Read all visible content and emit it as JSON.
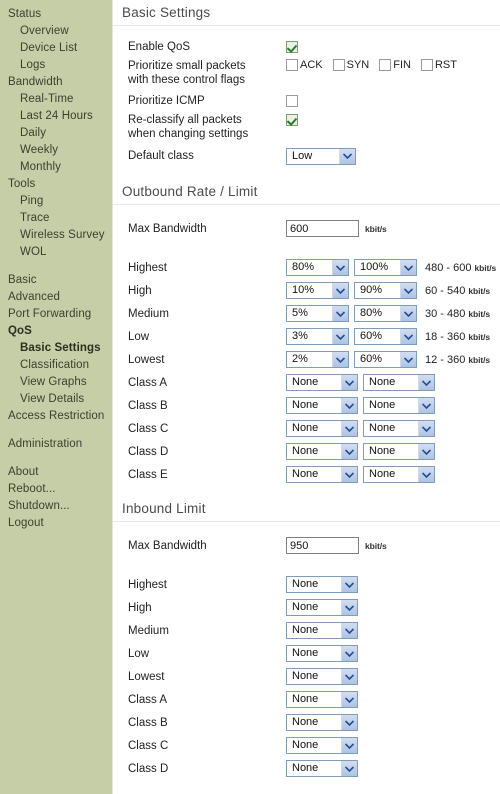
{
  "sidebar": {
    "items": [
      {
        "label": "Status",
        "level": 0,
        "active": false
      },
      {
        "label": "Overview",
        "level": 1,
        "active": false
      },
      {
        "label": "Device List",
        "level": 1,
        "active": false
      },
      {
        "label": "Logs",
        "level": 1,
        "active": false
      },
      {
        "label": "Bandwidth",
        "level": 0,
        "active": false
      },
      {
        "label": "Real-Time",
        "level": 1,
        "active": false
      },
      {
        "label": "Last 24 Hours",
        "level": 1,
        "active": false
      },
      {
        "label": "Daily",
        "level": 1,
        "active": false
      },
      {
        "label": "Weekly",
        "level": 1,
        "active": false
      },
      {
        "label": "Monthly",
        "level": 1,
        "active": false
      },
      {
        "label": "Tools",
        "level": 0,
        "active": false
      },
      {
        "label": "Ping",
        "level": 1,
        "active": false
      },
      {
        "label": "Trace",
        "level": 1,
        "active": false
      },
      {
        "label": "Wireless Survey",
        "level": 1,
        "active": false
      },
      {
        "label": "WOL",
        "level": 1,
        "active": false
      },
      {
        "label": "",
        "level": -1,
        "active": false
      },
      {
        "label": "Basic",
        "level": 0,
        "active": false
      },
      {
        "label": "Advanced",
        "level": 0,
        "active": false
      },
      {
        "label": "Port Forwarding",
        "level": 0,
        "active": false
      },
      {
        "label": "QoS",
        "level": 0,
        "active": true
      },
      {
        "label": "Basic Settings",
        "level": 1,
        "active": true
      },
      {
        "label": "Classification",
        "level": 1,
        "active": false
      },
      {
        "label": "View Graphs",
        "level": 1,
        "active": false
      },
      {
        "label": "View Details",
        "level": 1,
        "active": false
      },
      {
        "label": "Access Restriction",
        "level": 0,
        "active": false
      },
      {
        "label": "",
        "level": -1,
        "active": false
      },
      {
        "label": "Administration",
        "level": 0,
        "active": false
      },
      {
        "label": "",
        "level": -1,
        "active": false
      },
      {
        "label": "About",
        "level": 0,
        "active": false
      },
      {
        "label": "Reboot...",
        "level": 0,
        "active": false
      },
      {
        "label": "Shutdown...",
        "level": 0,
        "active": false
      },
      {
        "label": "Logout",
        "level": 0,
        "active": false
      }
    ]
  },
  "basic_settings": {
    "title": "Basic Settings",
    "enable_qos": {
      "label": "Enable QoS",
      "checked": true
    },
    "prioritize_small_packets": {
      "label_line1": "Prioritize small packets",
      "label_line2": "with these control flags",
      "flags": [
        {
          "label": "ACK",
          "checked": false
        },
        {
          "label": "SYN",
          "checked": false
        },
        {
          "label": "FIN",
          "checked": false
        },
        {
          "label": "RST",
          "checked": false
        }
      ]
    },
    "prioritize_icmp": {
      "label": "Prioritize ICMP",
      "checked": false
    },
    "reclassify": {
      "label_line1": "Re-classify all packets",
      "label_line2": "when changing settings",
      "checked": true
    },
    "default_class": {
      "label": "Default class",
      "value": "Low"
    }
  },
  "outbound": {
    "title": "Outbound Rate / Limit",
    "max_bandwidth": {
      "label": "Max Bandwidth",
      "value": "600",
      "unit": "kbit/s"
    },
    "unit": "kbit/s",
    "rows": [
      {
        "label": "Highest",
        "rate": "80%",
        "limit": "100%",
        "range": "480 - 600"
      },
      {
        "label": "High",
        "rate": "10%",
        "limit": "90%",
        "range": "60 - 540"
      },
      {
        "label": "Medium",
        "rate": "5%",
        "limit": "80%",
        "range": "30 - 480"
      },
      {
        "label": "Low",
        "rate": "3%",
        "limit": "60%",
        "range": "18 - 360"
      },
      {
        "label": "Lowest",
        "rate": "2%",
        "limit": "60%",
        "range": "12 - 360"
      },
      {
        "label": "Class A",
        "rate": "None",
        "limit": "None",
        "range": ""
      },
      {
        "label": "Class B",
        "rate": "None",
        "limit": "None",
        "range": ""
      },
      {
        "label": "Class C",
        "rate": "None",
        "limit": "None",
        "range": ""
      },
      {
        "label": "Class D",
        "rate": "None",
        "limit": "None",
        "range": ""
      },
      {
        "label": "Class E",
        "rate": "None",
        "limit": "None",
        "range": ""
      }
    ]
  },
  "inbound": {
    "title": "Inbound Limit",
    "max_bandwidth": {
      "label": "Max Bandwidth",
      "value": "950",
      "unit": "kbit/s"
    },
    "rows": [
      {
        "label": "Highest",
        "limit": "None"
      },
      {
        "label": "High",
        "limit": "None"
      },
      {
        "label": "Medium",
        "limit": "None"
      },
      {
        "label": "Low",
        "limit": "None"
      },
      {
        "label": "Lowest",
        "limit": "None"
      },
      {
        "label": "Class A",
        "limit": "None"
      },
      {
        "label": "Class B",
        "limit": "None"
      },
      {
        "label": "Class C",
        "limit": "None"
      },
      {
        "label": "Class D",
        "limit": "None"
      }
    ]
  },
  "colors": {
    "sidebar_bg": "#c6cea7",
    "select_border": "#7f9db9",
    "check_green": "#2f7a2f"
  }
}
